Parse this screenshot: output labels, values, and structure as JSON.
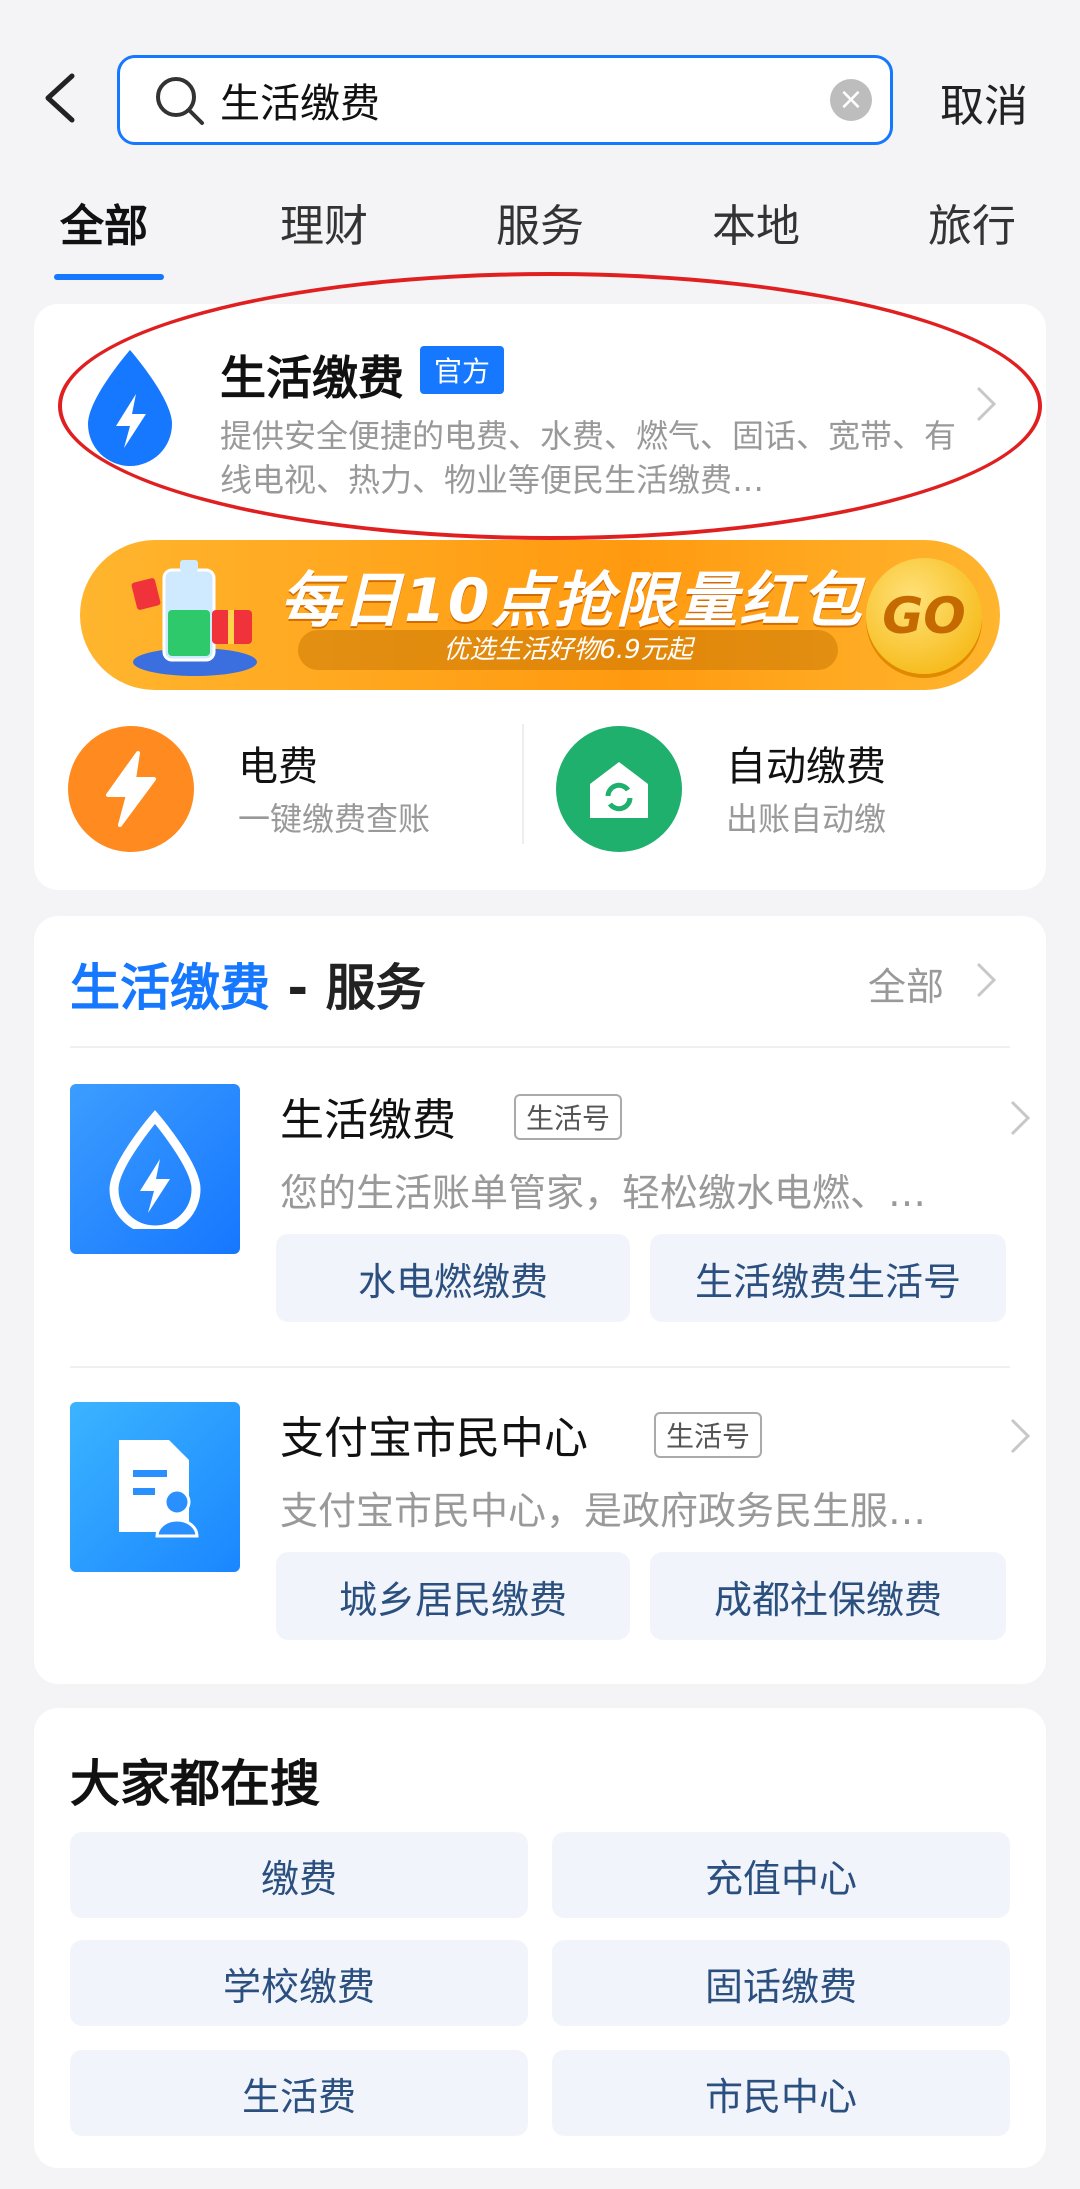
{
  "search": {
    "query": "生活缴费",
    "cancel_label": "取消"
  },
  "tabs": [
    {
      "label": "全部"
    },
    {
      "label": "理财"
    },
    {
      "label": "服务"
    },
    {
      "label": "本地"
    },
    {
      "label": "旅行"
    }
  ],
  "official": {
    "title": "生活缴费",
    "badge": "官方",
    "description": "提供安全便捷的电费、水费、燃气、固话、宽带、有线电视、热力、物业等便民生活缴费…"
  },
  "banner": {
    "title": "每日10点抢限量红包",
    "subtitle": "优选生活好物6.9元起",
    "go_label": "GO"
  },
  "quick_services": [
    {
      "title": "电费",
      "subtitle": "一键缴费查账",
      "icon": "lightning-icon",
      "color": "#ff8a1f"
    },
    {
      "title": "自动缴费",
      "subtitle": "出账自动缴",
      "icon": "auto-pay-house-icon",
      "color": "#1eb06c"
    }
  ],
  "service_section": {
    "heading_highlight": "生活缴费",
    "heading_rest": " - 服务",
    "all_label": "全部",
    "items": [
      {
        "title": "生活缴费",
        "tag": "生活号",
        "description": "您的生活账单管家，轻松缴水电燃、…",
        "icon": "water-drop-lightning-icon",
        "links": [
          "水电燃缴费",
          "生活缴费生活号"
        ]
      },
      {
        "title": "支付宝市民中心",
        "tag": "生活号",
        "description": "支付宝市民中心，是政府政务民生服…",
        "icon": "citizen-document-icon",
        "links": [
          "城乡居民缴费",
          "成都社保缴费"
        ]
      }
    ]
  },
  "popular": {
    "heading": "大家都在搜",
    "items": [
      "缴费",
      "充值中心",
      "学校缴费",
      "固话缴费",
      "生活费",
      "市民中心"
    ]
  },
  "colors": {
    "accent": "#1677ff",
    "highlight_ring": "#e02020"
  }
}
